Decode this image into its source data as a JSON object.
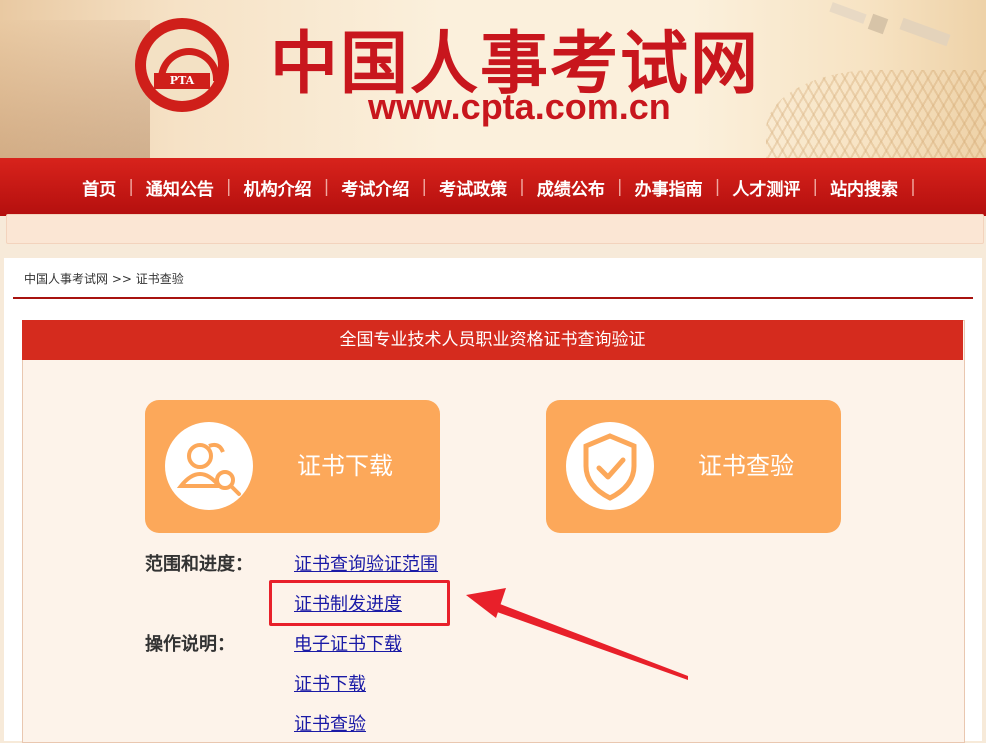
{
  "header": {
    "site_title": "中国人事考试网",
    "site_url": "www.cpta.com.cn",
    "logo_text": "PTA"
  },
  "nav": {
    "items": [
      "首页",
      "通知公告",
      "机构介绍",
      "考试介绍",
      "考试政策",
      "成绩公布",
      "办事指南",
      "人才测评",
      "站内搜索"
    ]
  },
  "breadcrumb": {
    "home": "中国人事考试网",
    "separator": ">>",
    "current": "证书查验"
  },
  "card": {
    "title": "全国专业技术人员职业资格证书查询验证",
    "download_button": "证书下载",
    "verify_button": "证书查验",
    "scope_label": "范围和进度：",
    "scope_links": [
      "证书查询验证范围",
      "证书制发进度"
    ],
    "ops_label": "操作说明：",
    "ops_links": [
      "电子证书下载",
      "证书下载",
      "证书查验"
    ]
  },
  "colors": {
    "brand_red": "#c8161d",
    "nav_red": "#d8231c",
    "button_orange": "#fca85a",
    "link_blue": "#1a1aa6",
    "highlight_red": "#e8202a"
  },
  "icons": {
    "download": "users-search-icon",
    "verify": "shield-check-icon"
  }
}
